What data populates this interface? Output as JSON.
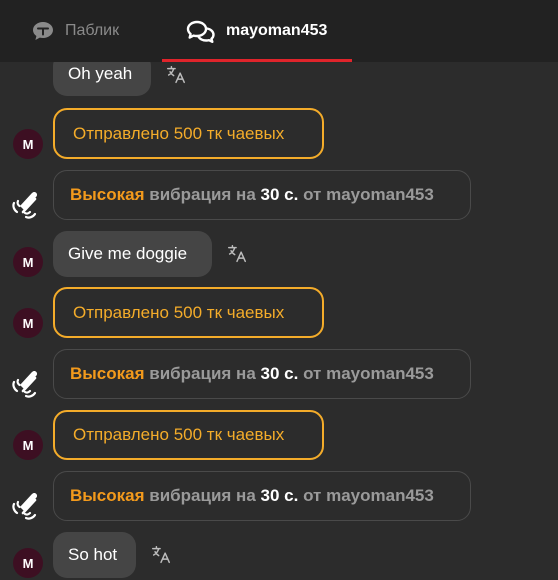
{
  "tabs": {
    "public_label": "Паблик",
    "private_label": "mayoman453",
    "active": "mayoman453"
  },
  "colors": {
    "accent_tab": "#e0242b",
    "tip": "#f4ac2a",
    "vibration_level": "#f39a1c",
    "avatar_bg": "#3d0f22"
  },
  "messages": [
    {
      "type": "text",
      "avatar": "M",
      "text": "Oh yeah",
      "translate_icon": "translate-icon"
    },
    {
      "type": "tip",
      "avatar": "M",
      "text": "Отправлено 500 тк чаевых"
    },
    {
      "type": "vibration",
      "icon": "vibration-icon",
      "level": "Высокая",
      "mid": "вибрация на",
      "duration": "30 с.",
      "from": "от",
      "user": "mayoman453"
    },
    {
      "type": "text",
      "avatar": "M",
      "text": "Give me doggie",
      "translate_icon": "translate-icon"
    },
    {
      "type": "tip",
      "avatar": "M",
      "text": "Отправлено 500 тк чаевых"
    },
    {
      "type": "vibration",
      "icon": "vibration-icon",
      "level": "Высокая",
      "mid": "вибрация на",
      "duration": "30 с.",
      "from": "от",
      "user": "mayoman453"
    },
    {
      "type": "tip",
      "avatar": "M",
      "text": "Отправлено 500 тк чаевых"
    },
    {
      "type": "vibration",
      "icon": "vibration-icon",
      "level": "Высокая",
      "mid": "вибрация на",
      "duration": "30 с.",
      "from": "от",
      "user": "mayoman453"
    },
    {
      "type": "text",
      "avatar": "M",
      "text": "So hot",
      "translate_icon": "translate-icon"
    }
  ]
}
